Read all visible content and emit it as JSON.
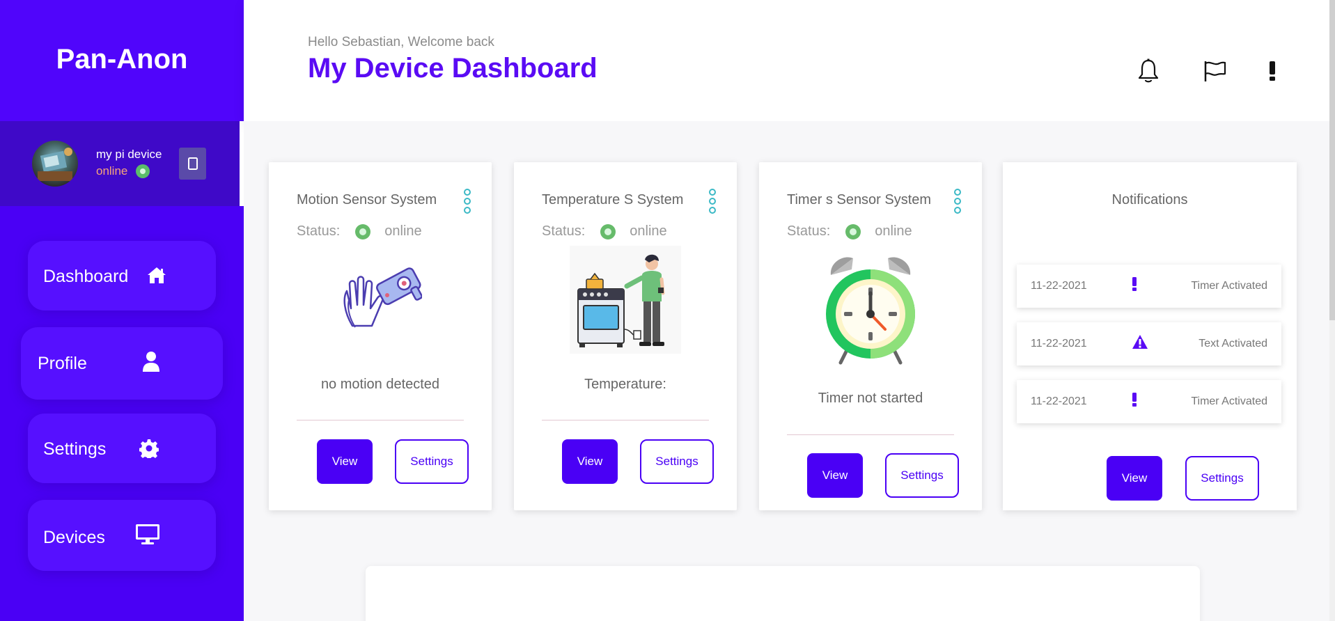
{
  "sidebar": {
    "brand": "Pan-Anon",
    "device": {
      "name": "my pi device",
      "status": "online"
    },
    "nav": [
      {
        "label": "Dashboard",
        "icon": "home-icon"
      },
      {
        "label": "Profile",
        "icon": "user-icon"
      },
      {
        "label": "Settings",
        "icon": "gear-icon"
      },
      {
        "label": "Devices",
        "icon": "monitor-icon"
      }
    ]
  },
  "header": {
    "greeting": "Hello Sebastian, Welcome back",
    "title": "My Device Dashboard",
    "icons": [
      "bell-icon",
      "flag-icon",
      "exclamation-icon"
    ]
  },
  "cards": [
    {
      "title": "Motion Sensor System",
      "status_label": "Status:",
      "status": "online",
      "text": "no motion detected",
      "view_label": "View",
      "settings_label": "Settings",
      "illustration": "motion-sensor-illustration"
    },
    {
      "title": "Temperature S System",
      "status_label": "Status:",
      "status": "online",
      "text": "Temperature:",
      "view_label": "View",
      "settings_label": "Settings",
      "illustration": "temperature-illustration"
    },
    {
      "title": "Timer s Sensor System",
      "status_label": "Status:",
      "status": "online",
      "text": "Timer not started",
      "view_label": "View",
      "settings_label": "Settings",
      "illustration": "alarm-clock-illustration"
    }
  ],
  "notifications": {
    "title": "Notifications",
    "items": [
      {
        "date": "11-22-2021",
        "icon": "exclamation-icon",
        "message": "Timer Activated"
      },
      {
        "date": "11-22-2021",
        "icon": "warning-icon",
        "message": "Text Activated"
      },
      {
        "date": "11-22-2021",
        "icon": "exclamation-icon",
        "message": "Timer Activated"
      }
    ],
    "view_label": "View",
    "settings_label": "Settings"
  },
  "colors": {
    "accent": "#4a00f5",
    "sidebar": "#4a00f5",
    "title": "#5a0bf4",
    "online": "#66bb6a"
  }
}
